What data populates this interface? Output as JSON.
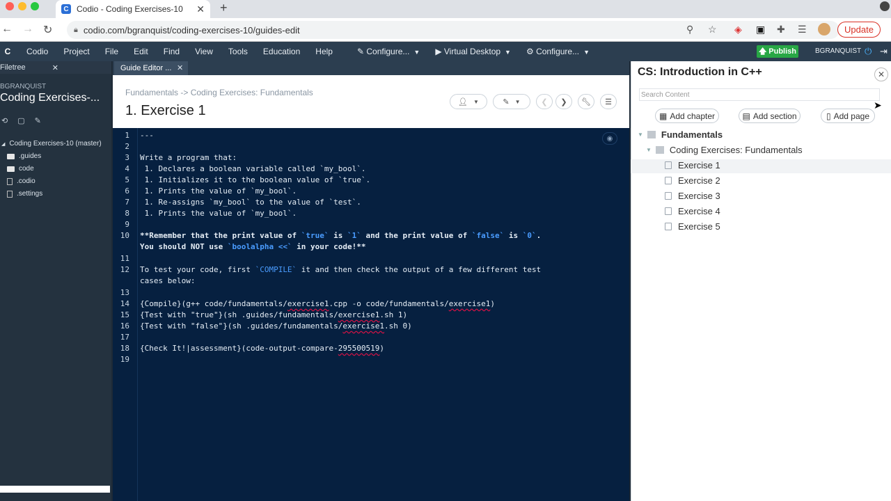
{
  "browser": {
    "tab_title": "Codio - Coding Exercises-10",
    "favicon_letter": "C",
    "url": "codio.com/bgranquist/coding-exercises-10/guides-edit",
    "update_label": "Update"
  },
  "menu": {
    "logo": "C",
    "items": [
      "Codio",
      "Project",
      "File",
      "Edit",
      "Find",
      "View",
      "Tools",
      "Education",
      "Help"
    ],
    "configure1": "Configure...",
    "virtual_desktop": "Virtual Desktop",
    "configure2": "Configure...",
    "publish": "Publish",
    "user": "BGRANQUIST"
  },
  "filetree": {
    "tab_label": "Filetree",
    "user": "BGRANQUIST",
    "project": "Coding Exercises-...",
    "root": "Coding Exercises-10 (master)",
    "items": [
      ".guides",
      "code",
      ".codio",
      ".settings"
    ]
  },
  "editor": {
    "tab_label": "Guide Editor ...",
    "breadcrumb": "Fundamentals -> Coding Exercises: Fundamentals",
    "page_title": "1. Exercise 1",
    "line_numbers": [
      "1",
      "2",
      "3",
      "4",
      "5",
      "6",
      "7",
      "8",
      "9",
      "10",
      "",
      "11",
      "12",
      "",
      "13",
      "14",
      "15",
      "16",
      "17",
      "18",
      "19"
    ],
    "lines": {
      "l1": "---",
      "l3": "Write a program that:",
      "l4": " 1. Declares a boolean variable called `my_bool`.",
      "l5": " 1. Initializes it to the boolean value of `true`.",
      "l6": " 1. Prints the value of `my_bool`.",
      "l7": " 1. Re-assigns `my_bool` to the value of `test`.",
      "l8": " 1. Prints the value of `my_bool`.",
      "l10a": "**Remember that the print value of ",
      "l10b": "`true`",
      "l10c": " is ",
      "l10d": "`1`",
      "l10e": " and the print value of ",
      "l10f": "`false`",
      "l10g": " is ",
      "l10h": "`0`",
      "l10i": ".",
      "l10j": "You should NOT use ",
      "l10k": "`boolalpha <<`",
      "l10l": " in your code!**",
      "l12a": "To test your code, first ",
      "l12b": "`COMPILE`",
      "l12c": " it and then check the output of a few different test",
      "l12d": "cases below:",
      "l14a": "{Compile}(g++ code/fundamentals/",
      "l14b": "exercise1",
      "l14c": ".cpp -o code/fundamentals/",
      "l14d": "exercise1",
      "l14e": ")",
      "l15a": "{Test with \"true\"}(sh .guides/fundamentals/",
      "l15b": "exercise1",
      "l15c": ".sh 1)",
      "l16a": "{Test with \"false\"}(sh .guides/fundamentals/",
      "l16b": "exercise1",
      "l16c": ".sh 0)",
      "l18a": "{Check It!|assessment}(code-output-compare-",
      "l18b": "295500519",
      "l18c": ")"
    }
  },
  "panel": {
    "title": "CS: Introduction in C++",
    "search_placeholder": "Search Content",
    "add_chapter": "Add chapter",
    "add_section": "Add section",
    "add_page": "Add page",
    "chapter": "Fundamentals",
    "section": "Coding Exercises: Fundamentals",
    "pages": [
      "Exercise 1",
      "Exercise 2",
      "Exercise 3",
      "Exercise 4",
      "Exercise 5"
    ]
  },
  "colors": {
    "menu_bg": "#2c3e50",
    "editor_bg": "#062040",
    "publish": "#28a745",
    "update": "#d93025"
  }
}
